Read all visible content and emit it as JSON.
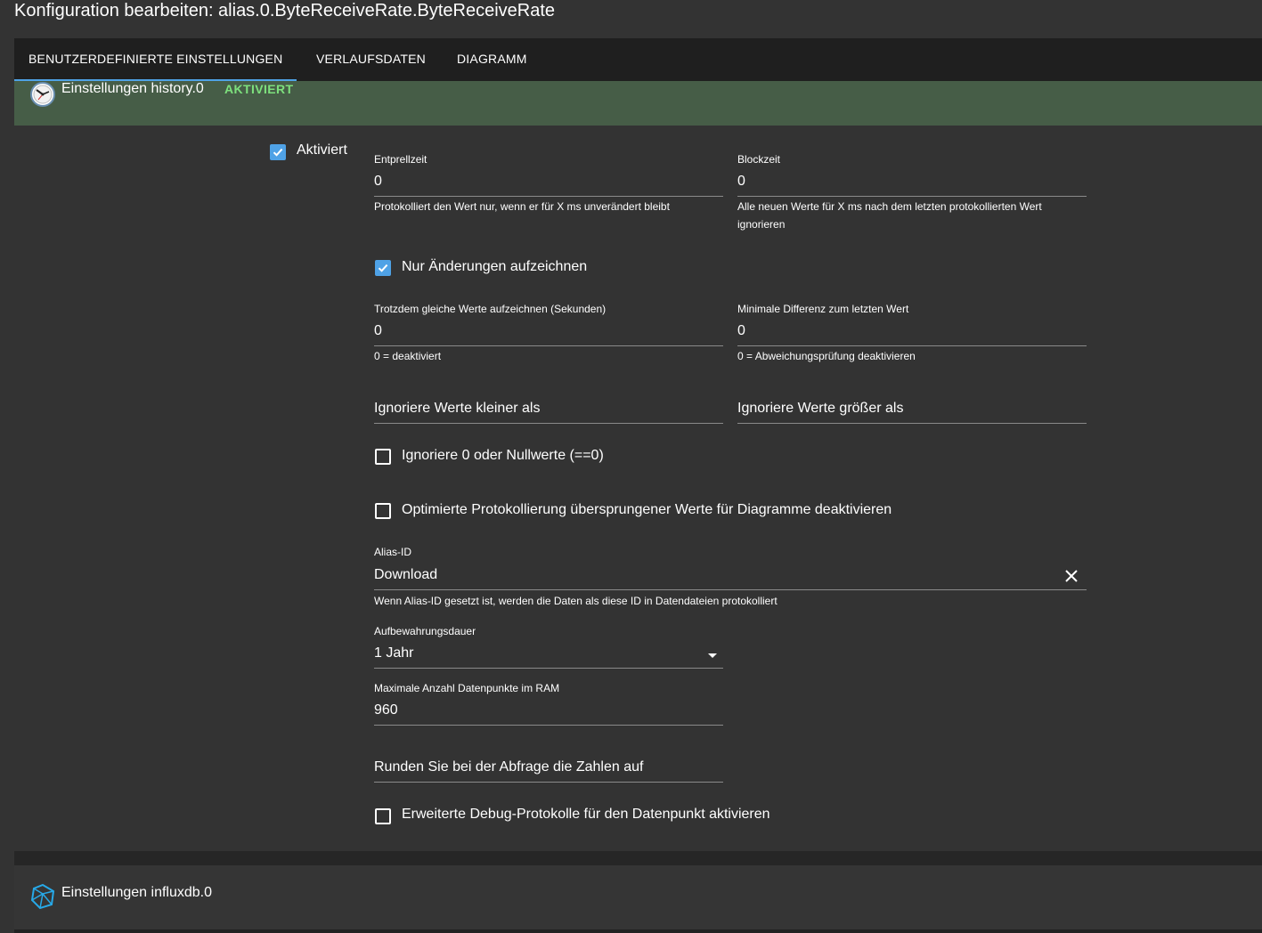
{
  "page_title": "Konfiguration bearbeiten: alias.0.ByteReceiveRate.ByteReceiveRate",
  "tabs": [
    {
      "label": "BENUTZERDEFINIERTE EINSTELLUNGEN",
      "active": true
    },
    {
      "label": "VERLAUFSDATEN",
      "active": false
    },
    {
      "label": "DIAGRAMM",
      "active": false
    }
  ],
  "history_section": {
    "icon": "clock-icon",
    "title": "Einstellungen history.0",
    "status": "AKTIVIERT",
    "enabled": {
      "label": "Aktiviert",
      "checked": true
    },
    "debounce": {
      "label": "Entprellzeit",
      "value": "0",
      "helper": "Protokolliert den Wert nur, wenn er für X ms unverändert bleibt"
    },
    "blocktime": {
      "label": "Blockzeit",
      "value": "0",
      "helper": "Alle neuen Werte für X ms nach dem letzten protokollierten Wert ignorieren"
    },
    "changes_only": {
      "label": "Nur Änderungen aufzeichnen",
      "checked": true
    },
    "changes_relog": {
      "label": "Trotzdem gleiche Werte aufzeichnen (Sekunden)",
      "value": "0",
      "helper": "0 = deaktiviert"
    },
    "changes_min_delta": {
      "label": "Minimale Differenz zum letzten Wert",
      "value": "0",
      "helper": "0 = Abweichungsprüfung deaktivieren"
    },
    "ignore_below": {
      "placeholder": "Ignoriere Werte kleiner als"
    },
    "ignore_above": {
      "placeholder": "Ignoriere Werte größer als"
    },
    "ignore_zero": {
      "label": "Ignoriere 0 oder Nullwerte (==0)",
      "checked": false
    },
    "disable_skipped": {
      "label": "Optimierte Protokollierung übersprungener Werte für Diagramme deaktivieren",
      "checked": false
    },
    "alias_id": {
      "label": "Alias-ID",
      "value": "Download",
      "helper": "Wenn Alias-ID gesetzt ist, werden die Daten als diese ID in Datendateien protokolliert"
    },
    "retention": {
      "label": "Aufbewahrungsdauer",
      "value": "1 Jahr"
    },
    "max_points": {
      "label": "Maximale Anzahl Datenpunkte im RAM",
      "value": "960"
    },
    "round": {
      "placeholder": "Runden Sie bei der Abfrage die Zahlen auf"
    },
    "debug": {
      "label": "Erweiterte Debug-Protokolle für den Datenpunkt aktivieren",
      "checked": false
    }
  },
  "influx_section": {
    "icon": "influxdb-icon",
    "title": "Einstellungen influxdb.0"
  },
  "colors": {
    "accent": "#4fa2e6",
    "status_green": "#7de07d",
    "header_green": "#465d47",
    "background": "#333333"
  }
}
